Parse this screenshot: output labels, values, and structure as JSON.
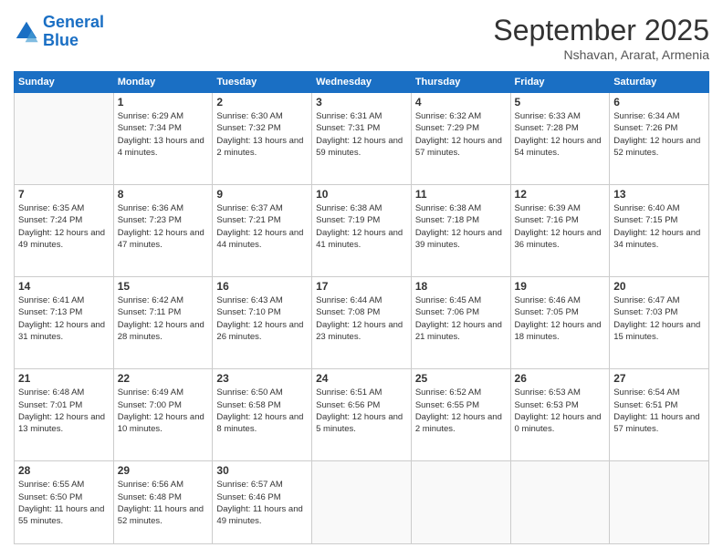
{
  "logo": {
    "line1": "General",
    "line2": "Blue"
  },
  "title": "September 2025",
  "subtitle": "Nshavan, Ararat, Armenia",
  "days_of_week": [
    "Sunday",
    "Monday",
    "Tuesday",
    "Wednesday",
    "Thursday",
    "Friday",
    "Saturday"
  ],
  "weeks": [
    [
      {
        "num": "",
        "sunrise": "",
        "sunset": "",
        "daylight": ""
      },
      {
        "num": "1",
        "sunrise": "Sunrise: 6:29 AM",
        "sunset": "Sunset: 7:34 PM",
        "daylight": "Daylight: 13 hours and 4 minutes."
      },
      {
        "num": "2",
        "sunrise": "Sunrise: 6:30 AM",
        "sunset": "Sunset: 7:32 PM",
        "daylight": "Daylight: 13 hours and 2 minutes."
      },
      {
        "num": "3",
        "sunrise": "Sunrise: 6:31 AM",
        "sunset": "Sunset: 7:31 PM",
        "daylight": "Daylight: 12 hours and 59 minutes."
      },
      {
        "num": "4",
        "sunrise": "Sunrise: 6:32 AM",
        "sunset": "Sunset: 7:29 PM",
        "daylight": "Daylight: 12 hours and 57 minutes."
      },
      {
        "num": "5",
        "sunrise": "Sunrise: 6:33 AM",
        "sunset": "Sunset: 7:28 PM",
        "daylight": "Daylight: 12 hours and 54 minutes."
      },
      {
        "num": "6",
        "sunrise": "Sunrise: 6:34 AM",
        "sunset": "Sunset: 7:26 PM",
        "daylight": "Daylight: 12 hours and 52 minutes."
      }
    ],
    [
      {
        "num": "7",
        "sunrise": "Sunrise: 6:35 AM",
        "sunset": "Sunset: 7:24 PM",
        "daylight": "Daylight: 12 hours and 49 minutes."
      },
      {
        "num": "8",
        "sunrise": "Sunrise: 6:36 AM",
        "sunset": "Sunset: 7:23 PM",
        "daylight": "Daylight: 12 hours and 47 minutes."
      },
      {
        "num": "9",
        "sunrise": "Sunrise: 6:37 AM",
        "sunset": "Sunset: 7:21 PM",
        "daylight": "Daylight: 12 hours and 44 minutes."
      },
      {
        "num": "10",
        "sunrise": "Sunrise: 6:38 AM",
        "sunset": "Sunset: 7:19 PM",
        "daylight": "Daylight: 12 hours and 41 minutes."
      },
      {
        "num": "11",
        "sunrise": "Sunrise: 6:38 AM",
        "sunset": "Sunset: 7:18 PM",
        "daylight": "Daylight: 12 hours and 39 minutes."
      },
      {
        "num": "12",
        "sunrise": "Sunrise: 6:39 AM",
        "sunset": "Sunset: 7:16 PM",
        "daylight": "Daylight: 12 hours and 36 minutes."
      },
      {
        "num": "13",
        "sunrise": "Sunrise: 6:40 AM",
        "sunset": "Sunset: 7:15 PM",
        "daylight": "Daylight: 12 hours and 34 minutes."
      }
    ],
    [
      {
        "num": "14",
        "sunrise": "Sunrise: 6:41 AM",
        "sunset": "Sunset: 7:13 PM",
        "daylight": "Daylight: 12 hours and 31 minutes."
      },
      {
        "num": "15",
        "sunrise": "Sunrise: 6:42 AM",
        "sunset": "Sunset: 7:11 PM",
        "daylight": "Daylight: 12 hours and 28 minutes."
      },
      {
        "num": "16",
        "sunrise": "Sunrise: 6:43 AM",
        "sunset": "Sunset: 7:10 PM",
        "daylight": "Daylight: 12 hours and 26 minutes."
      },
      {
        "num": "17",
        "sunrise": "Sunrise: 6:44 AM",
        "sunset": "Sunset: 7:08 PM",
        "daylight": "Daylight: 12 hours and 23 minutes."
      },
      {
        "num": "18",
        "sunrise": "Sunrise: 6:45 AM",
        "sunset": "Sunset: 7:06 PM",
        "daylight": "Daylight: 12 hours and 21 minutes."
      },
      {
        "num": "19",
        "sunrise": "Sunrise: 6:46 AM",
        "sunset": "Sunset: 7:05 PM",
        "daylight": "Daylight: 12 hours and 18 minutes."
      },
      {
        "num": "20",
        "sunrise": "Sunrise: 6:47 AM",
        "sunset": "Sunset: 7:03 PM",
        "daylight": "Daylight: 12 hours and 15 minutes."
      }
    ],
    [
      {
        "num": "21",
        "sunrise": "Sunrise: 6:48 AM",
        "sunset": "Sunset: 7:01 PM",
        "daylight": "Daylight: 12 hours and 13 minutes."
      },
      {
        "num": "22",
        "sunrise": "Sunrise: 6:49 AM",
        "sunset": "Sunset: 7:00 PM",
        "daylight": "Daylight: 12 hours and 10 minutes."
      },
      {
        "num": "23",
        "sunrise": "Sunrise: 6:50 AM",
        "sunset": "Sunset: 6:58 PM",
        "daylight": "Daylight: 12 hours and 8 minutes."
      },
      {
        "num": "24",
        "sunrise": "Sunrise: 6:51 AM",
        "sunset": "Sunset: 6:56 PM",
        "daylight": "Daylight: 12 hours and 5 minutes."
      },
      {
        "num": "25",
        "sunrise": "Sunrise: 6:52 AM",
        "sunset": "Sunset: 6:55 PM",
        "daylight": "Daylight: 12 hours and 2 minutes."
      },
      {
        "num": "26",
        "sunrise": "Sunrise: 6:53 AM",
        "sunset": "Sunset: 6:53 PM",
        "daylight": "Daylight: 12 hours and 0 minutes."
      },
      {
        "num": "27",
        "sunrise": "Sunrise: 6:54 AM",
        "sunset": "Sunset: 6:51 PM",
        "daylight": "Daylight: 11 hours and 57 minutes."
      }
    ],
    [
      {
        "num": "28",
        "sunrise": "Sunrise: 6:55 AM",
        "sunset": "Sunset: 6:50 PM",
        "daylight": "Daylight: 11 hours and 55 minutes."
      },
      {
        "num": "29",
        "sunrise": "Sunrise: 6:56 AM",
        "sunset": "Sunset: 6:48 PM",
        "daylight": "Daylight: 11 hours and 52 minutes."
      },
      {
        "num": "30",
        "sunrise": "Sunrise: 6:57 AM",
        "sunset": "Sunset: 6:46 PM",
        "daylight": "Daylight: 11 hours and 49 minutes."
      },
      {
        "num": "",
        "sunrise": "",
        "sunset": "",
        "daylight": ""
      },
      {
        "num": "",
        "sunrise": "",
        "sunset": "",
        "daylight": ""
      },
      {
        "num": "",
        "sunrise": "",
        "sunset": "",
        "daylight": ""
      },
      {
        "num": "",
        "sunrise": "",
        "sunset": "",
        "daylight": ""
      }
    ]
  ]
}
